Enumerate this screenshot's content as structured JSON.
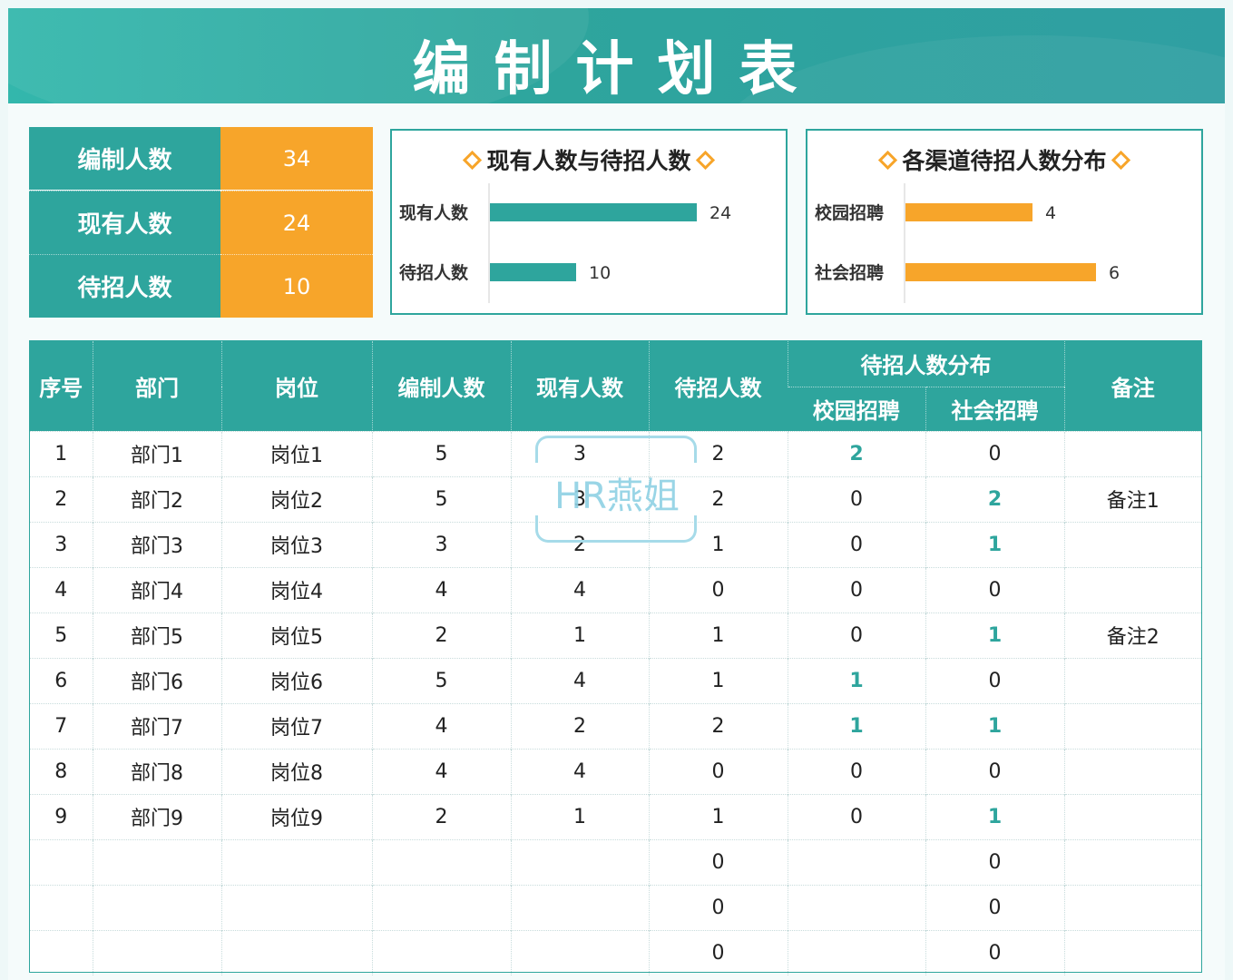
{
  "title": "编制计划表",
  "summary": [
    {
      "label": "编制人数",
      "value": "34"
    },
    {
      "label": "现有人数",
      "value": "24"
    },
    {
      "label": "待招人数",
      "value": "10"
    }
  ],
  "colors": {
    "teal": "#2ea59d",
    "orange": "#f7a52a"
  },
  "chart_data": [
    {
      "type": "bar",
      "orientation": "horizontal",
      "title": "现有人数与待招人数",
      "categories": [
        "现有人数",
        "待招人数"
      ],
      "values": [
        24,
        10
      ],
      "color": "#2ea59d",
      "xlim": [
        0,
        24
      ]
    },
    {
      "type": "bar",
      "orientation": "horizontal",
      "title": "各渠道待招人数分布",
      "categories": [
        "校园招聘",
        "社会招聘"
      ],
      "values": [
        4,
        6
      ],
      "color": "#f7a52a",
      "xlim": [
        0,
        6
      ]
    }
  ],
  "table": {
    "headers": {
      "seq": "序号",
      "dept": "部门",
      "post": "岗位",
      "planned": "编制人数",
      "current": "现有人数",
      "pending": "待招人数",
      "dist": "待招人数分布",
      "campus": "校园招聘",
      "social": "社会招聘",
      "remark": "备注"
    },
    "rows": [
      [
        "1",
        "部门1",
        "岗位1",
        "5",
        "3",
        "2",
        "2",
        "0",
        ""
      ],
      [
        "2",
        "部门2",
        "岗位2",
        "5",
        "3",
        "2",
        "0",
        "2",
        "备注1"
      ],
      [
        "3",
        "部门3",
        "岗位3",
        "3",
        "2",
        "1",
        "0",
        "1",
        ""
      ],
      [
        "4",
        "部门4",
        "岗位4",
        "4",
        "4",
        "0",
        "0",
        "0",
        ""
      ],
      [
        "5",
        "部门5",
        "岗位5",
        "2",
        "1",
        "1",
        "0",
        "1",
        "备注2"
      ],
      [
        "6",
        "部门6",
        "岗位6",
        "5",
        "4",
        "1",
        "1",
        "0",
        ""
      ],
      [
        "7",
        "部门7",
        "岗位7",
        "4",
        "2",
        "2",
        "1",
        "1",
        ""
      ],
      [
        "8",
        "部门8",
        "岗位8",
        "4",
        "4",
        "0",
        "0",
        "0",
        ""
      ],
      [
        "9",
        "部门9",
        "岗位9",
        "2",
        "1",
        "1",
        "0",
        "1",
        ""
      ],
      [
        "",
        "",
        "",
        "",
        "",
        "0",
        "",
        "0",
        ""
      ],
      [
        "",
        "",
        "",
        "",
        "",
        "0",
        "",
        "0",
        ""
      ],
      [
        "",
        "",
        "",
        "",
        "",
        "0",
        "",
        "0",
        ""
      ]
    ]
  },
  "watermark": "HR燕姐"
}
